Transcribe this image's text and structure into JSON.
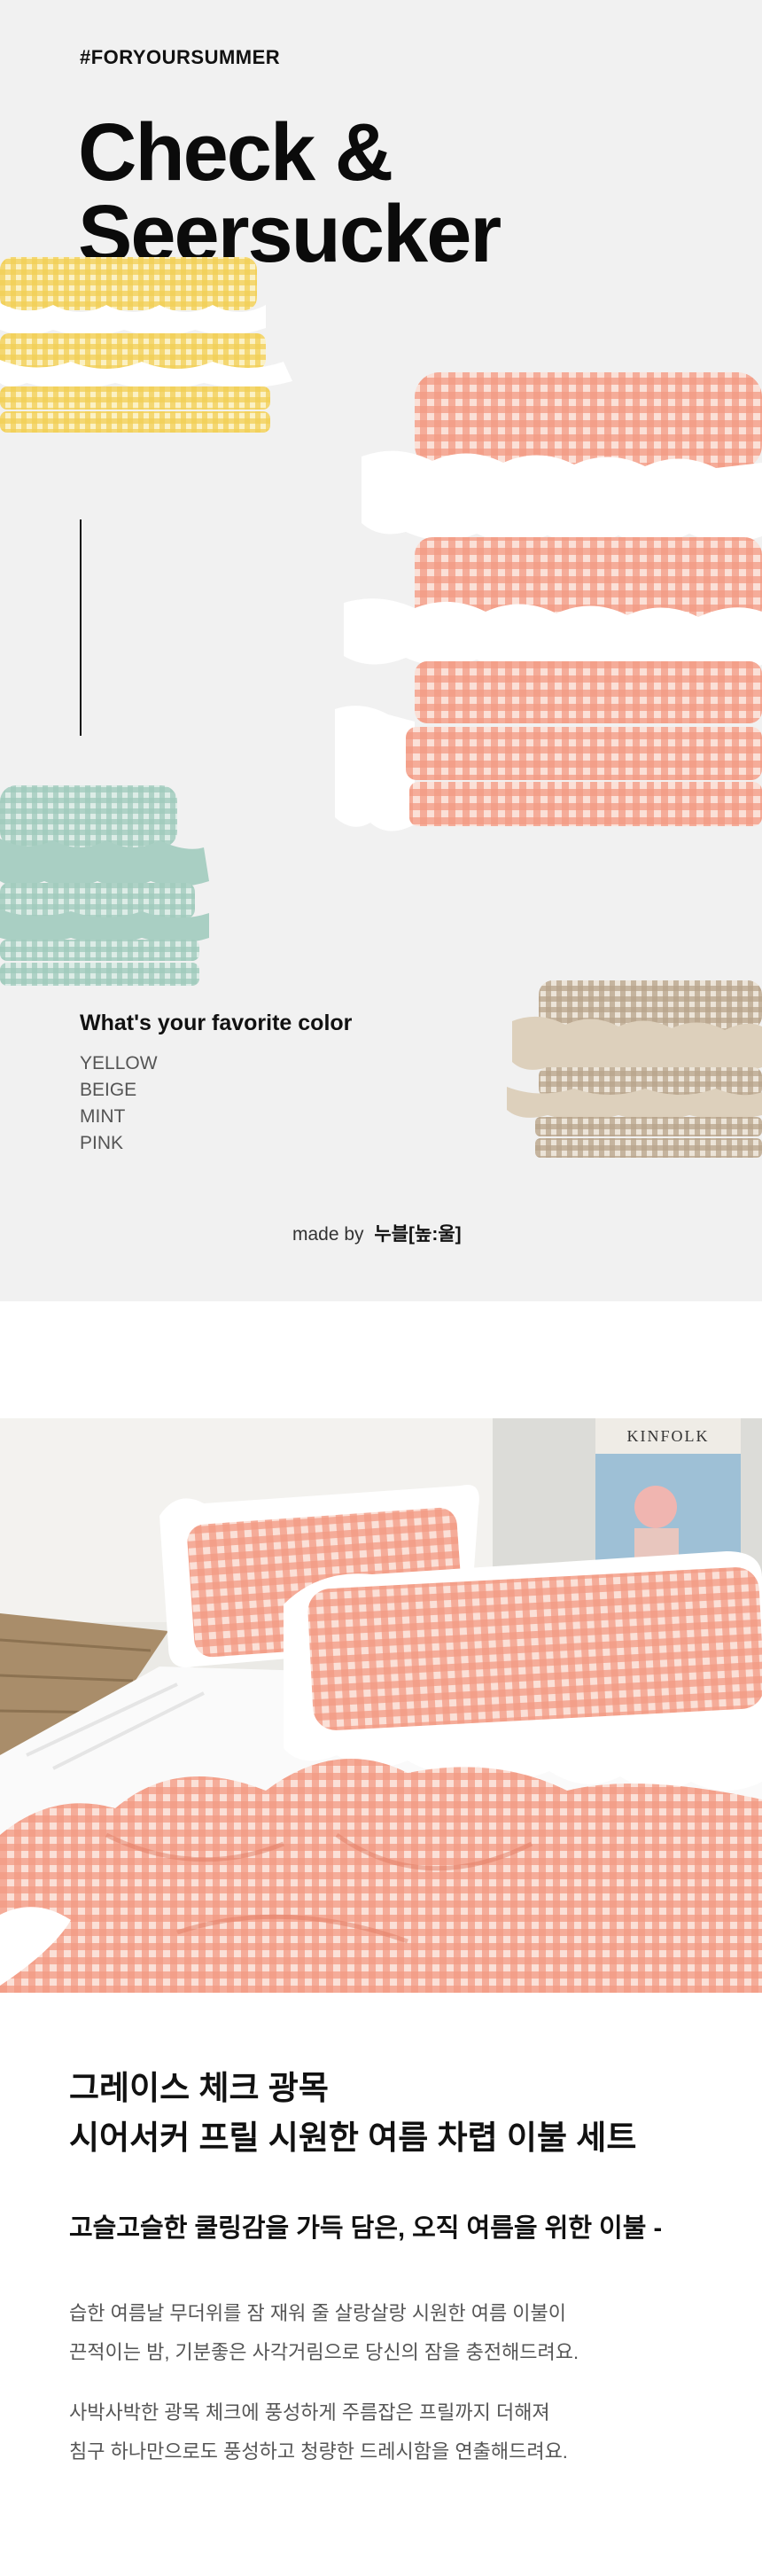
{
  "hero": {
    "hashtag": "#FORYOURSUMMER",
    "title_line1": "Check &",
    "title_line2": "Seersucker",
    "question": "What's your favorite color",
    "colors": [
      "YELLOW",
      "BEIGE",
      "MINT",
      "PINK"
    ],
    "madeby_prefix": "made by",
    "madeby_brand": "누블[높:울]",
    "background": "#f1f1f1"
  },
  "photo": {
    "book_title": "KINFOLK"
  },
  "product": {
    "heading_line1": "그레이스 체크 광목",
    "heading_line2": "시어서커 프릴 시원한 여름 차렵 이불 세트",
    "subheading": "고슬고슬한 쿨링감을 가득 담은, 오직 여름을 위한 이불 -",
    "para1_line1": "습한 여름날 무더위를 잠 재워 줄 살랑살랑 시원한 여름 이불이",
    "para1_line2": "끈적이는 밤, 기분좋은 사각거림으로 당신의 잠을 충전해드려요.",
    "para2_line1": "사박사박한 광목 체크에 풍성하게 주름잡은 프릴까지 더해져",
    "para2_line2": "침구 하나만으로도 풍성하고 청량한 드레시함을 연출해드려요."
  },
  "palette": {
    "yellow": "#f3d46a",
    "beige": "#c9b9a2",
    "mint": "#a9cfc3",
    "pink": "#f39a84"
  }
}
